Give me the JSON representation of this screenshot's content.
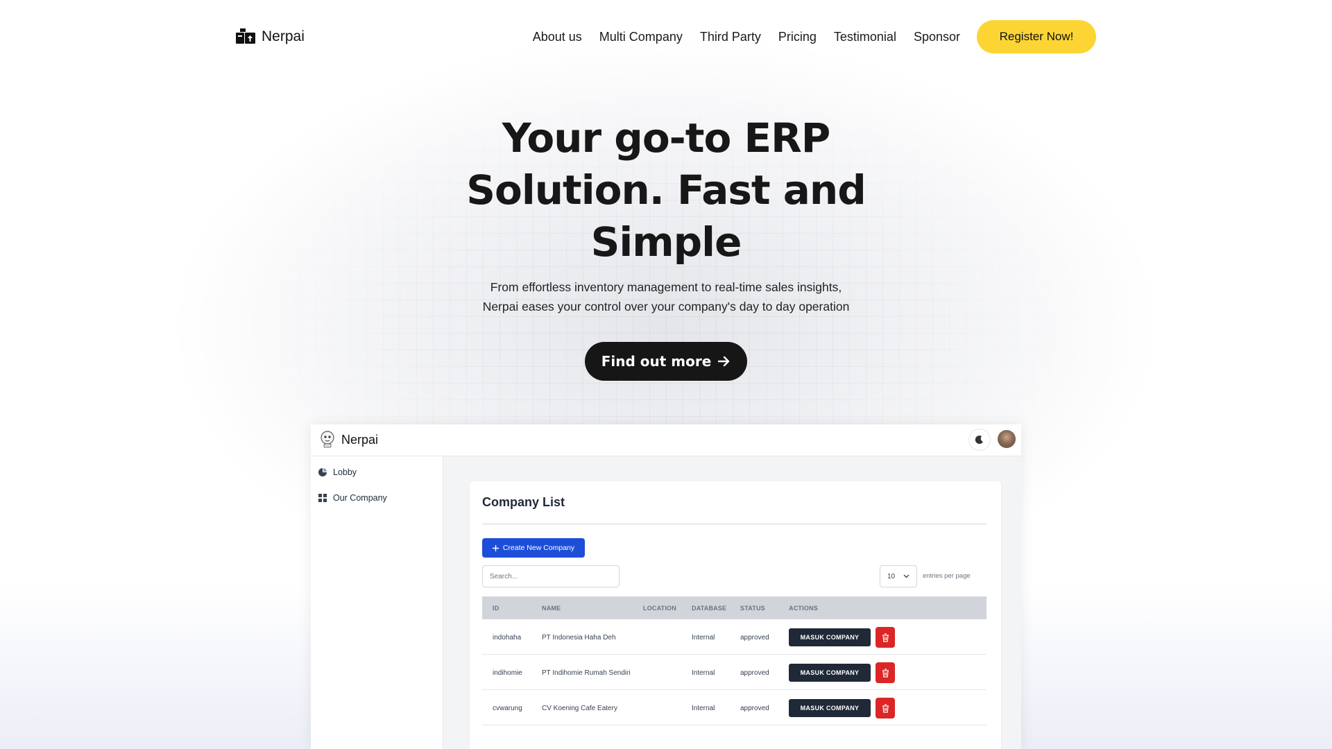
{
  "site": {
    "brand": "Nerpai",
    "nav_links": [
      "About us",
      "Multi Company",
      "Third Party",
      "Pricing",
      "Testimonial",
      "Sponsor"
    ],
    "register_label": "Register Now!"
  },
  "hero": {
    "title": "Your go-to ERP Solution. Fast and Simple",
    "subtitle_line1": "From effortless inventory management to real-time sales insights,",
    "subtitle_line2": "Nerpai eases your control over your company's day to day operation",
    "cta_label": "Find out more",
    "cta_icon": "arrow-right-icon"
  },
  "app": {
    "name": "Nerpai",
    "sidebar": [
      {
        "label": "Lobby",
        "icon": "pie-chart-icon"
      },
      {
        "label": "Our Company",
        "icon": "grid-icon"
      }
    ],
    "card_title": "Company List",
    "create_label": "Create New Company",
    "search_placeholder": "Search...",
    "per_page_value": "10",
    "per_page_label": "entries per page",
    "columns": [
      "ID",
      "NAME",
      "LOCATION",
      "DATABASE",
      "STATUS",
      "ACTIONS"
    ],
    "rows": [
      {
        "id": "indohaha",
        "name": "PT Indonesia Haha Deh",
        "location": "",
        "database": "Internal",
        "status": "approved"
      },
      {
        "id": "indihomie",
        "name": "PT Indihomie Rumah Sendiri",
        "location": "",
        "database": "Internal",
        "status": "approved"
      },
      {
        "id": "cvwarung",
        "name": "CV Koening Cafe Eatery",
        "location": "",
        "database": "Internal",
        "status": "approved"
      }
    ],
    "action_label": "MASUK COMPANY",
    "colors": {
      "accent": "#fcd535",
      "primary": "#1d4ed8",
      "danger": "#dc2626",
      "dark": "#1f2937"
    }
  }
}
